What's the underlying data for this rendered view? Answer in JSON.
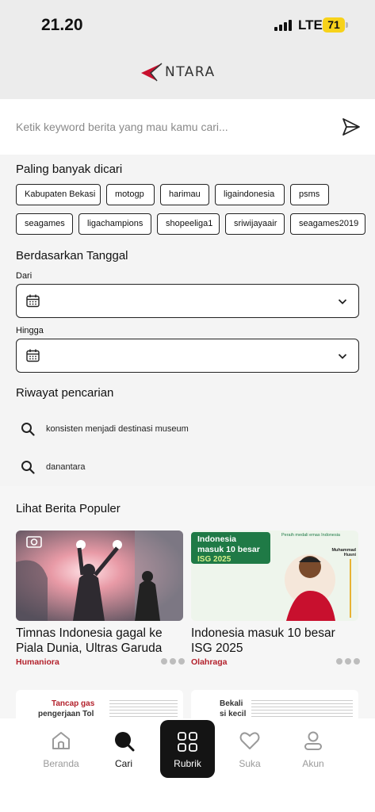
{
  "status": {
    "time": "21.20",
    "network": "LTE",
    "battery": "71"
  },
  "header": {
    "logo_text": "NTARA"
  },
  "search": {
    "placeholder": "Ketik keyword berita yang mau kamu cari...",
    "value": ""
  },
  "popular_searches": {
    "title": "Paling banyak dicari",
    "row1": [
      "Kabupaten Bekasi",
      "motogp",
      "harimau",
      "ligaindonesia",
      "psms"
    ],
    "row2": [
      "seagames",
      "ligachampions",
      "shopeeliga1",
      "sriwijayaair",
      "seagames2019"
    ]
  },
  "date_filter": {
    "title": "Berdasarkan Tanggal",
    "from_label": "Dari",
    "to_label": "Hingga"
  },
  "history": {
    "title": "Riwayat pencarian",
    "items": [
      "konsisten menjadi destinasi museum",
      "danantara"
    ]
  },
  "popular_news": {
    "title": "Lihat Berita Populer",
    "cards": [
      {
        "title": "Timnas Indonesia gagal ke Piala Dunia, Ultras Garuda",
        "category": "Humaniora"
      },
      {
        "title": "Indonesia masuk 10 besar ISG 2025",
        "category": "Olahraga"
      }
    ],
    "infographic": {
      "headline_1": "Indonesia",
      "headline_2": "masuk 10 besar",
      "headline_3": "ISG 2025",
      "side_title": "Peraih medali emas Indonesia",
      "athlete_name": "Muhammad Husni",
      "partial_1": "Tancap gas",
      "partial_2": "pengerjaan Tol",
      "partial_3": "Bekali",
      "partial_4": "si kecil"
    }
  },
  "bottom_nav": {
    "items": [
      {
        "label": "Beranda",
        "icon": "home-icon"
      },
      {
        "label": "Cari",
        "icon": "search-icon"
      },
      {
        "label": "Rubrik",
        "icon": "grid-icon"
      },
      {
        "label": "Suka",
        "icon": "heart-icon"
      },
      {
        "label": "Akun",
        "icon": "user-icon"
      }
    ]
  },
  "colors": {
    "brand_red": "#c8102e",
    "category_red": "#b3212c",
    "battery": "#f7d21a"
  }
}
